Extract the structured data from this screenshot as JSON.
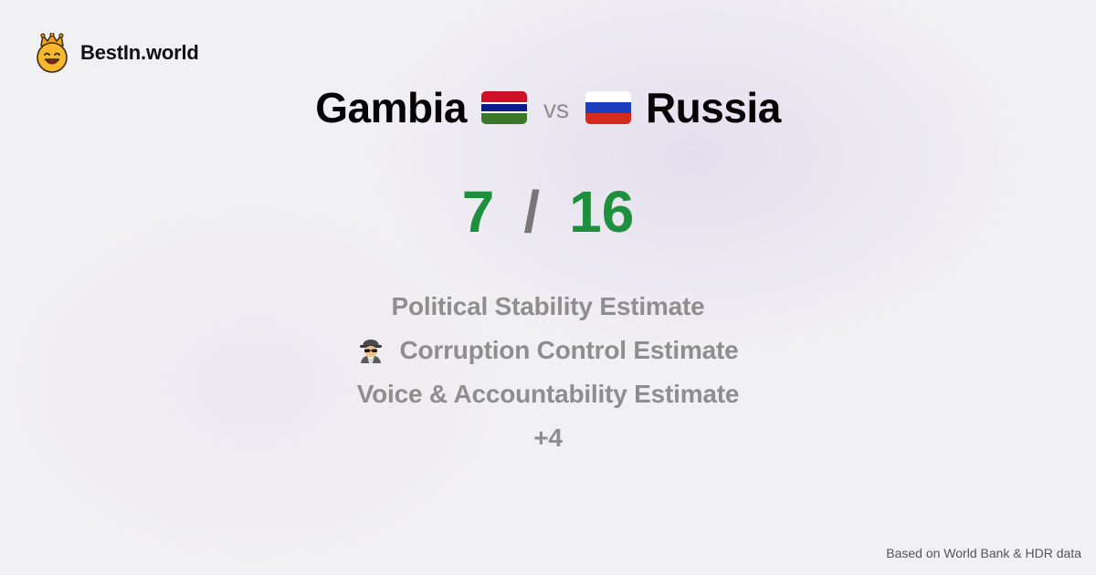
{
  "brand": {
    "name": "BestIn.world",
    "icon": "crowned-smiley-icon"
  },
  "comparison": {
    "left_country": "Gambia",
    "left_flag": "gambia-flag-icon",
    "vs_label": "vs",
    "right_country": "Russia",
    "right_flag": "russia-flag-icon"
  },
  "score": {
    "left": "7",
    "separator": "/",
    "right": "16",
    "color": "#1e8f3d"
  },
  "criteria": {
    "items": [
      {
        "label": "Political Stability Estimate",
        "icon": ""
      },
      {
        "label": "Corruption Control Estimate",
        "icon": "detective-icon"
      },
      {
        "label": "Voice & Accountability Estimate",
        "icon": ""
      }
    ],
    "more": "+4"
  },
  "footer": {
    "source": "Based on World Bank & HDR data"
  }
}
